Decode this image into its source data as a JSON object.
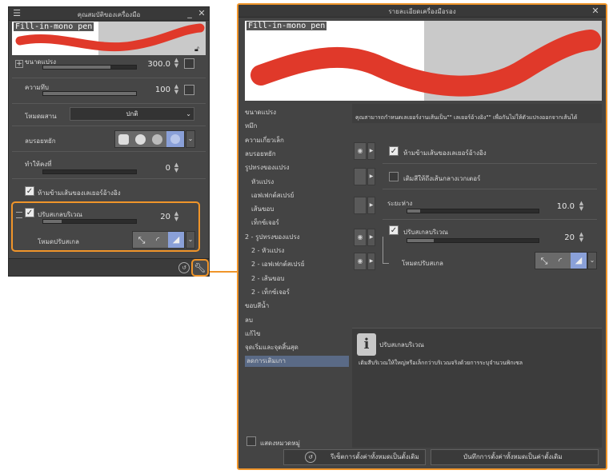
{
  "left_panel": {
    "title": "คุณสมบัติของเครื่องมือ",
    "preview_label": "Fill-in-mono pen",
    "brush_size": {
      "label": "ขนาดแปรง",
      "value": "300.0",
      "fill": 0.72
    },
    "thickness": {
      "label": "ความทึบ",
      "value": "100",
      "fill": 1.0
    },
    "blend_mode": {
      "label": "โหมดผสาน",
      "value": "ปกติ"
    },
    "anti_alias": {
      "label": "ลบรอยหยัก"
    },
    "stabilization": {
      "label": "ทำให้คงที่",
      "value": "0"
    },
    "no_cross_ref": {
      "label": "ห้ามข้ามเส้นของเลเยอร์อ้างอิง",
      "checked": true
    },
    "area_scaling": {
      "label": "ปรับสเกลบริเวณ",
      "value": "20",
      "checked": true,
      "fill": 0.2
    },
    "scale_mode": {
      "label": "โหมดปรับสเกล"
    }
  },
  "right_panel": {
    "title": "รายละเอียดเครื่องมือรอง",
    "preview_label": "Fill-in-mono pen",
    "categories": [
      {
        "label": "ขนาดแปรง",
        "sub": false
      },
      {
        "label": "หมึก",
        "sub": false
      },
      {
        "label": "ความเกี่ยวเล็ก",
        "sub": false
      },
      {
        "label": "ลบรอยหยัก",
        "sub": false
      },
      {
        "label": "รูปทรงของแปรง",
        "sub": false
      },
      {
        "label": "หัวแปรง",
        "sub": true
      },
      {
        "label": "เอฟเฟกต์สเปรย์",
        "sub": true
      },
      {
        "label": "เส้นขอบ",
        "sub": true
      },
      {
        "label": "เท็กซ์เจอร์",
        "sub": true
      },
      {
        "label": "2 - รูปทรงของแปรง",
        "sub": false
      },
      {
        "label": "2 - หัวแปรง",
        "sub": true
      },
      {
        "label": "2 - เอฟเฟกต์สเปรย์",
        "sub": true
      },
      {
        "label": "2 - เส้นขอบ",
        "sub": true
      },
      {
        "label": "2 - เท็กซ์เจอร์",
        "sub": true
      },
      {
        "label": "ขอบสีน้ำ",
        "sub": false
      },
      {
        "label": "ลบ",
        "sub": false
      },
      {
        "label": "แก้ไข",
        "sub": false
      },
      {
        "label": "จุดเริ่มและจุดสิ้นสุด",
        "sub": false
      },
      {
        "label": "ลดการเติมเกา",
        "sub": false,
        "selected": true
      }
    ],
    "show_all": "แสดงหมวดหมู่",
    "info_text": "คุณสามารถกำหนดเลเยอร์งานเส้นเป็น\"\" เลเยอร์อ้างอิง\"\" เพื่อกันไม่ให้ตัวแปรงออกจากเส้นได้",
    "no_cross_ref": "ห้ามข้ามเส้นของเลเยอร์อ้างอิง",
    "fill_closed": "เติมสีให้ถึงเส้นกลางเวกเตอร์",
    "gap": {
      "label": "ระยะห่าง",
      "value": "10.0",
      "fill": 0.1
    },
    "area_scaling": {
      "label": "ปรับสเกลบริเวณ",
      "value": "20",
      "fill": 0.2
    },
    "scale_mode": "โหมดปรับสเกล",
    "help_title": "ปรับสเกลบริเวณ",
    "help_text": "เติมสีบริเวณให้ใหญ่หรือเล็กกว่าบริเวณจริงด้วยการระบุจำนวนพิกเซล",
    "reset_button": "รีเซ็ตการตั้งค่าทั้งหมดเป็นตั้งเดิม",
    "register_button": "บันทึกการตั้งค่าทั้งหมดเป็นค่าตั้งเดิม"
  },
  "colors": {
    "accent": "#f0952a",
    "stroke": "#e0392a",
    "selected": "#5a6a86"
  }
}
